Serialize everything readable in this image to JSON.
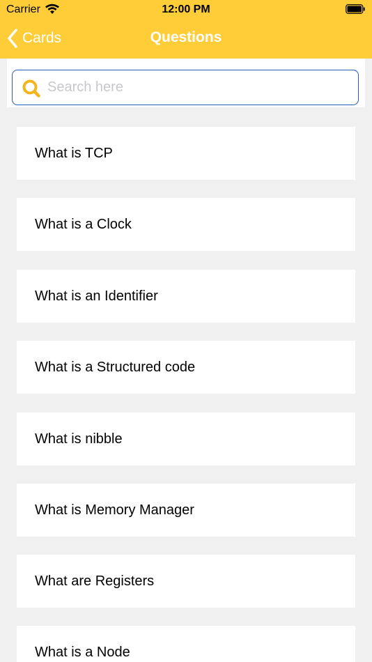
{
  "status_bar": {
    "carrier": "Carrier",
    "time": "12:00 PM"
  },
  "nav": {
    "back_label": "Cards",
    "title": "Questions"
  },
  "search": {
    "placeholder": "Search here",
    "value": ""
  },
  "questions": [
    "What is TCP",
    "What is a Clock",
    "What is an Identifier",
    "What is a Structured code",
    "What is nibble",
    "What is Memory Manager",
    "What are Registers",
    "What is a Node"
  ],
  "colors": {
    "header_yellow": "#ffcd38",
    "search_border": "#2a5bb8",
    "search_icon": "#f2b51f",
    "background": "#f0f0f0"
  }
}
